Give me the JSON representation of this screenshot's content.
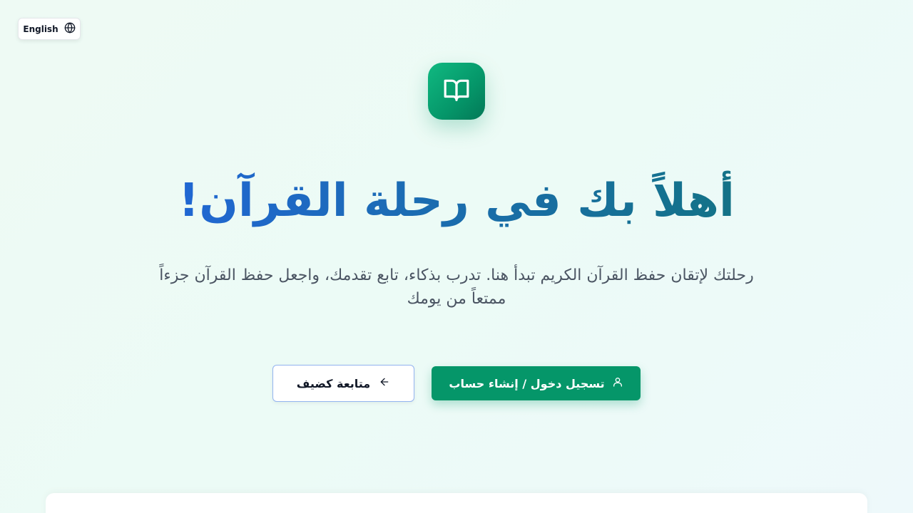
{
  "language_toggle": {
    "label": "English",
    "icon": "globe-icon"
  },
  "logo": {
    "icon": "open-book-icon"
  },
  "hero": {
    "title": "أهلاً بك في رحلة القرآن!",
    "subtitle": "رحلتك لإتقان حفظ القرآن الكريم تبدأ هنا. تدرب بذكاء، تابع تقدمك، واجعل حفظ القرآن جزءاً ممتعاً من يومك"
  },
  "actions": {
    "login_label": "تسجيل دخول / إنشاء حساب",
    "login_icon": "user-icon",
    "guest_label": "متابعة كضيف",
    "guest_icon": "arrow-left-icon"
  },
  "colors": {
    "primary": "#059669",
    "title_gradient_start": "#2563eb",
    "title_gradient_end": "#0f766e",
    "subtitle_text": "#4b5563"
  }
}
